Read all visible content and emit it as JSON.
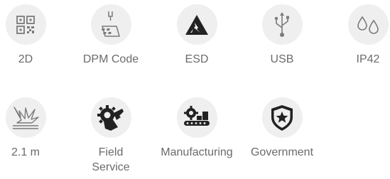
{
  "features": [
    {
      "label": "2D",
      "icon": "qr-code-icon"
    },
    {
      "label": "DPM Code",
      "icon": "dpm-laser-marking-icon"
    },
    {
      "label": "ESD",
      "icon": "esd-warning-icon"
    },
    {
      "label": "USB",
      "icon": "usb-icon"
    },
    {
      "label": "IP42",
      "icon": "water-drops-icon"
    },
    {
      "label": "2.1 m",
      "icon": "drop-impact-icon"
    },
    {
      "label": "Field Service",
      "icon": "field-service-gear-icon"
    },
    {
      "label": "Manufacturing",
      "icon": "manufacturing-conveyor-icon"
    },
    {
      "label": "Government",
      "icon": "government-shield-star-icon"
    }
  ],
  "colors": {
    "circle": "#efefef",
    "icon_line": "#7a7a7a",
    "icon_dark": "#222222",
    "label": "#6b6b6b"
  }
}
